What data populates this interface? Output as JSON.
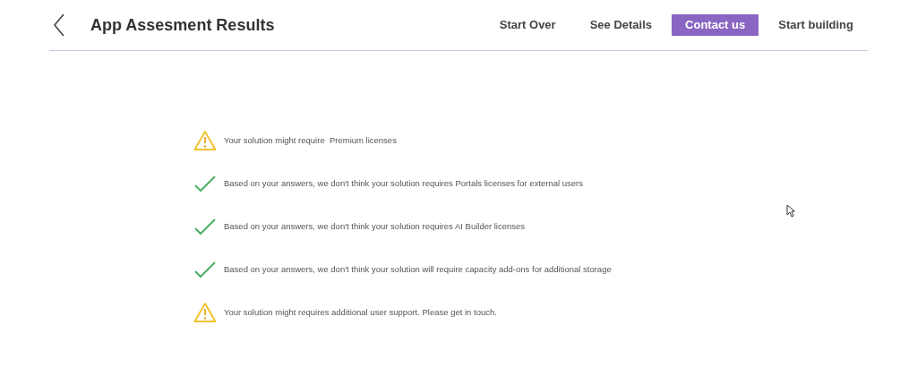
{
  "header": {
    "title": "App Assesment Results",
    "actions": [
      {
        "label": "Start Over",
        "kind": "plain"
      },
      {
        "label": "See Details",
        "kind": "plain"
      },
      {
        "label": "Contact us",
        "kind": "primary"
      },
      {
        "label": "Start building",
        "kind": "plain"
      }
    ]
  },
  "results": [
    {
      "kind": "warning",
      "text": "Your solution might require  Premium licenses"
    },
    {
      "kind": "ok",
      "text": "Based on your answers, we don't think your solution requires Portals licenses for external users"
    },
    {
      "kind": "ok",
      "text": "Based on your answers, we don't think your solution requires AI Builder licenses"
    },
    {
      "kind": "ok",
      "text": "Based on your answers, we don't think your solution will require capacity add-ons for additional storage"
    },
    {
      "kind": "warning",
      "text": "Your solution might requires additional user support. Please get in touch."
    }
  ]
}
